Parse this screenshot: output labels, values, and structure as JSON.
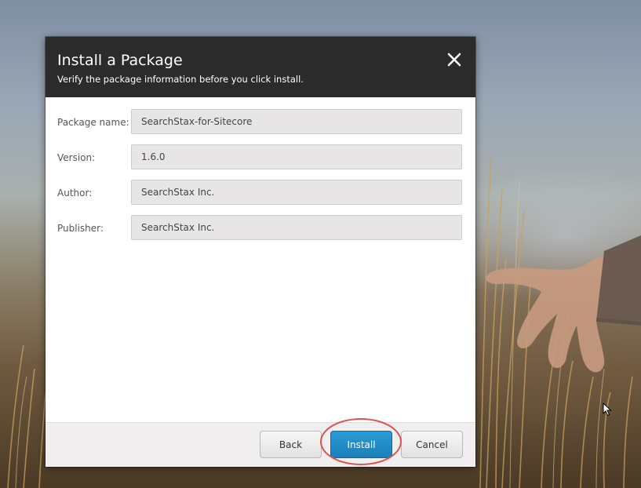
{
  "dialog": {
    "title": "Install a Package",
    "subtitle": "Verify the package information before you click install.",
    "close_icon": "close-icon",
    "fields": [
      {
        "label": "Package name:",
        "value": "SearchStax-for-Sitecore"
      },
      {
        "label": "Version:",
        "value": "1.6.0"
      },
      {
        "label": "Author:",
        "value": "SearchStax Inc."
      },
      {
        "label": "Publisher:",
        "value": "SearchStax Inc."
      }
    ],
    "buttons": {
      "back_label": "Back",
      "install_label": "Install",
      "cancel_label": "Cancel"
    }
  },
  "colors": {
    "header_bg": "#2b2b2b",
    "primary_button": "#1f8cc8",
    "field_bg": "#e8e5e6",
    "highlight": "#d9534f"
  }
}
